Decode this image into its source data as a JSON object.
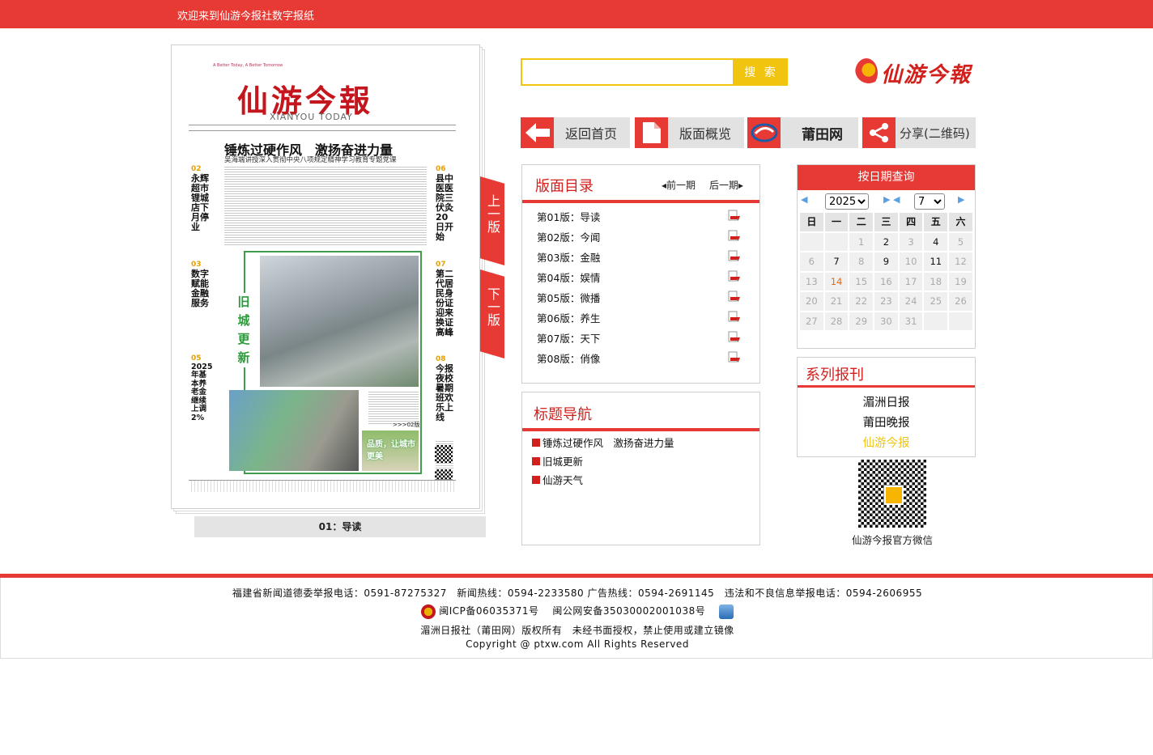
{
  "header": {
    "welcome": "欢迎来到仙游今报社数字报纸"
  },
  "newspaper": {
    "masthead": "仙游今報",
    "masthead_en": "XIANYOU TODAY",
    "strap": "A Better Today, A Better Tomorrow",
    "headline": "锤炼过硬作风　激扬奋进力量",
    "subhead": "吴海端讲授深入贯彻中央八项规定精神学习教育专题党课",
    "left_teasers": [
      {
        "num": "02",
        "text": "永辉超市锂城店下月停业"
      },
      {
        "num": "03",
        "text": "数字赋能金融服务"
      },
      {
        "num": "05",
        "text": "2025年基本养老金继续上调2%"
      }
    ],
    "right_teasers": [
      {
        "num": "06",
        "text": "县中医医院三伏灸20日开始"
      },
      {
        "num": "07",
        "text": "第二代居民身份证迎来换证高峰"
      },
      {
        "num": "08",
        "text": "今报夜校暑期班欢乐上线"
      }
    ],
    "feature_label": "旧城更新",
    "photo_caption": "品质，让城市更美",
    "more": ">>>02版",
    "page_caption": "01：导读"
  },
  "pager": {
    "prev": "上一版",
    "next": "下一版"
  },
  "search": {
    "placeholder": "",
    "value": "",
    "button": "搜 索"
  },
  "brand": {
    "name": "仙游今報"
  },
  "nav": [
    {
      "label": "返回首页",
      "icon": "arrow-left-icon"
    },
    {
      "label": "版面概览",
      "icon": "document-icon"
    },
    {
      "label": "莆田网",
      "icon": "ptxw-logo-icon"
    },
    {
      "label": "分享(二维码)",
      "icon": "share-icon"
    }
  ],
  "toc": {
    "title": "版面目录",
    "prev": "前一期",
    "next": "后一期",
    "items": [
      "第01版：导读",
      "第02版：今闻",
      "第03版：金融",
      "第04版：娱情",
      "第05版：微播",
      "第06版：养生",
      "第07版：天下",
      "第08版：俏像"
    ]
  },
  "headlines": {
    "title": "标题导航",
    "items": [
      "锤炼过硬作风　激扬奋进力量",
      "旧城更新",
      "仙游天气"
    ]
  },
  "calendar": {
    "title": "按日期查询",
    "year": "2025",
    "month": "7",
    "weekdays": [
      "日",
      "一",
      "二",
      "三",
      "四",
      "五",
      "六"
    ],
    "days": [
      "",
      "",
      "1",
      "2",
      "3",
      "4",
      "5",
      "6",
      "7",
      "8",
      "9",
      "10",
      "11",
      "12",
      "13",
      "14",
      "15",
      "16",
      "17",
      "18",
      "19",
      "20",
      "21",
      "22",
      "23",
      "24",
      "25",
      "26",
      "27",
      "28",
      "29",
      "30",
      "31",
      "",
      ""
    ],
    "published_days": [
      "2",
      "4",
      "7",
      "9",
      "11",
      "14"
    ],
    "selected_day": "14"
  },
  "series": {
    "title": "系列报刊",
    "items": [
      "湄洲日报",
      "莆田晚报",
      "仙游今报"
    ],
    "active": "仙游今报",
    "active_color": "#f1c40f"
  },
  "wechat": {
    "caption": "仙游今报官方微信"
  },
  "footer": {
    "line1": "福建省新闻道德委举报电话：0591-87275327　新闻热线：0594-2233580 广告热线：0594-2691145　违法和不良信息举报电话：0594-2606955",
    "icp": "闽ICP备06035371号",
    "police": "闽公网安备35030002001038号",
    "line3": "湄洲日报社（莆田网）版权所有　未经书面授权，禁止使用或建立镜像",
    "line4": "Copyright @ ptxw.com All Rights Reserved"
  },
  "colors": {
    "accent": "#e83a35",
    "search": "#f1c40f",
    "today": "#e86a10"
  }
}
